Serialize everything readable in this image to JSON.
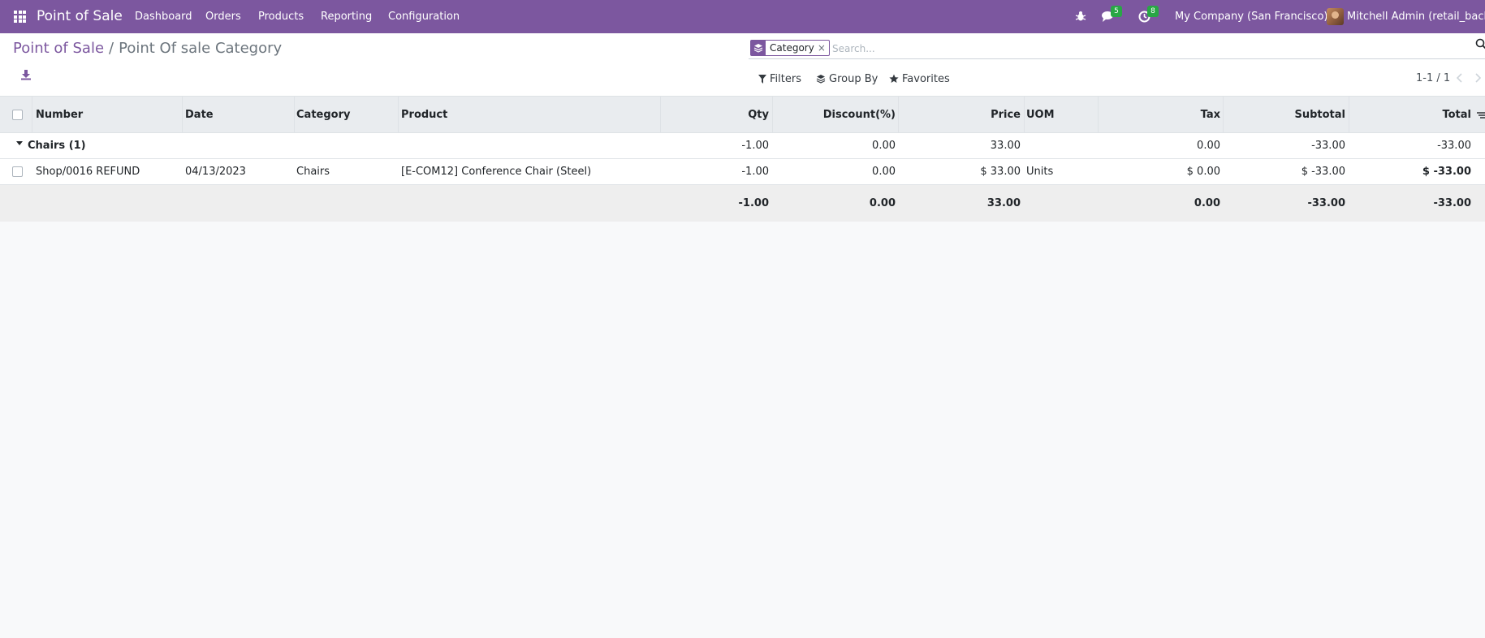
{
  "navbar": {
    "brand": "Point of Sale",
    "menu": [
      "Dashboard",
      "Orders",
      "Products",
      "Reporting",
      "Configuration"
    ],
    "messages_badge": "5",
    "activities_badge": "8",
    "company": "My Company (San Francisco)",
    "user": "Mitchell Admin (retail_backup"
  },
  "breadcrumb": {
    "parent": "Point of Sale",
    "separator": "/",
    "current": "Point Of sale Category"
  },
  "search": {
    "facet_label": "Category",
    "facet_close": "×",
    "placeholder": "Search..."
  },
  "toolbar": {
    "filters": "Filters",
    "group_by": "Group By",
    "favorites": "Favorites",
    "pager": "1-1 / 1"
  },
  "table": {
    "headers": {
      "number": "Number",
      "date": "Date",
      "category": "Category",
      "product": "Product",
      "qty": "Qty",
      "discount": "Discount(%)",
      "price": "Price",
      "uom": "UOM",
      "tax": "Tax",
      "subtotal": "Subtotal",
      "total": "Total"
    },
    "group": {
      "label": "Chairs (1)",
      "qty": "-1.00",
      "discount": "0.00",
      "price": "33.00",
      "tax": "0.00",
      "subtotal": "-33.00",
      "total": "-33.00"
    },
    "rows": [
      {
        "number": "Shop/0016 REFUND",
        "date": "04/13/2023",
        "category": "Chairs",
        "product": "[E-COM12] Conference Chair (Steel)",
        "qty": "-1.00",
        "discount": "0.00",
        "price": "$ 33.00",
        "uom": "Units",
        "tax": "$ 0.00",
        "subtotal": "$ -33.00",
        "total": "$ -33.00"
      }
    ],
    "totals": {
      "qty": "-1.00",
      "discount": "0.00",
      "price": "33.00",
      "tax": "0.00",
      "subtotal": "-33.00",
      "total": "-33.00"
    }
  },
  "colors": {
    "brand": "#7c579f",
    "badge": "#28a745"
  }
}
